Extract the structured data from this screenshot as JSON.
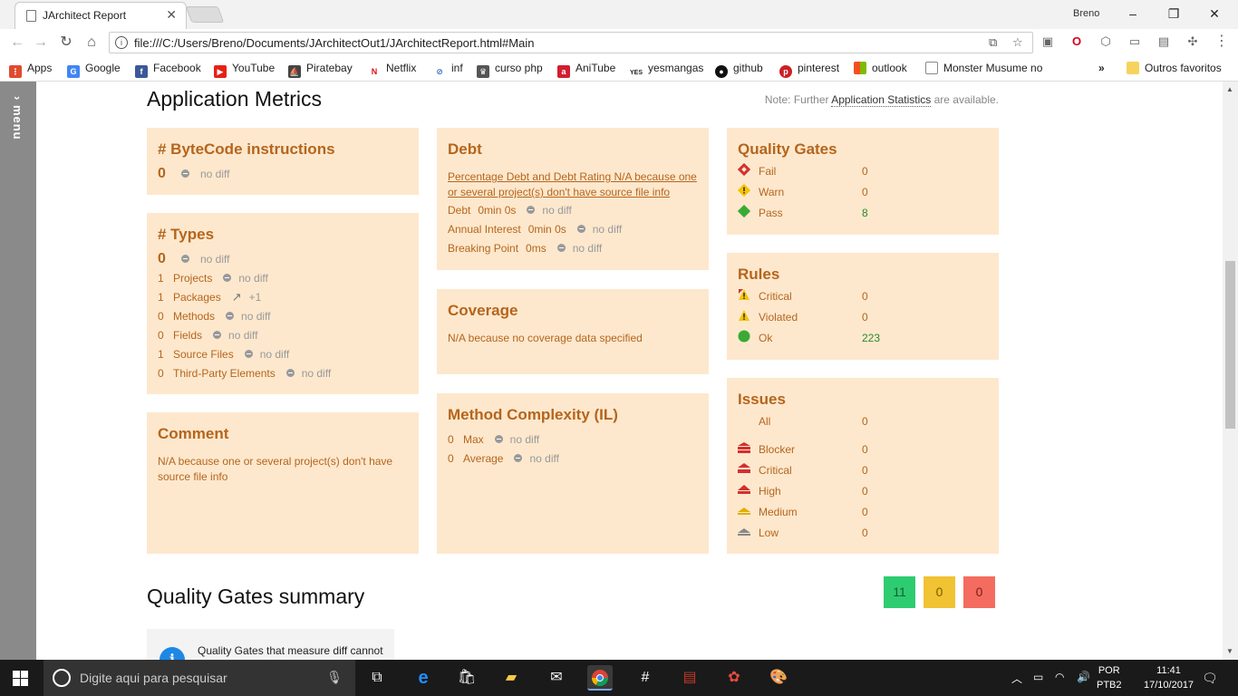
{
  "browser": {
    "tab_title": "JArchitect Report",
    "tab_close": "✕",
    "profile_name": "Breno",
    "url": "file:///C:/Users/Breno/Documents/JArchitectOut1/JArchitectReport.html#Main",
    "window_controls": [
      "–",
      "❐",
      "✕"
    ],
    "bookmarks": [
      {
        "label": "Apps",
        "icon": "apps-grid-icon",
        "color": "#e04a2f"
      },
      {
        "label": "Google",
        "icon": "google-icon",
        "color": "#4285f4"
      },
      {
        "label": "Facebook",
        "icon": "facebook-icon",
        "color": "#3b5998"
      },
      {
        "label": "YouTube",
        "icon": "youtube-icon",
        "color": "#e62117"
      },
      {
        "label": "Piratebay",
        "icon": "pirate-ship-icon",
        "color": "#444444"
      },
      {
        "label": "Netflix",
        "icon": "netflix-icon",
        "color": "#e50914"
      },
      {
        "label": "inf",
        "icon": "link-icon",
        "color": "#3a6bc9"
      },
      {
        "label": "curso php",
        "icon": "php-icon",
        "color": "#555555"
      },
      {
        "label": "AniTube",
        "icon": "anitube-icon",
        "color": "#d01f2f"
      },
      {
        "label": "yesmangas",
        "icon": "yesmangas-icon",
        "color": "#222222"
      },
      {
        "label": "github",
        "icon": "github-icon",
        "color": "#111111"
      },
      {
        "label": "pinterest",
        "icon": "pinterest-icon",
        "color": "#cb2027"
      },
      {
        "label": "outlook",
        "icon": "windows-icon",
        "color": "#f25022"
      },
      {
        "label": "Monster Musume no",
        "icon": "page-icon",
        "color": "#888888"
      }
    ],
    "bookmarks_more": "»",
    "other_bookmarks": "Outros favoritos"
  },
  "page": {
    "menu_label": "menu",
    "title": "Application Metrics",
    "note_prefix": "Note: Further",
    "note_link": "Application Statistics",
    "note_suffix": "are available.",
    "bytecode": {
      "title": "# ByteCode instructions",
      "value": "0",
      "diff": "no diff"
    },
    "types": {
      "title": "# Types",
      "value": "0",
      "diff": "no diff",
      "rows": [
        {
          "num": "1",
          "label": "Projects",
          "diff": "no diff",
          "icon": "no-diff-icon"
        },
        {
          "num": "1",
          "label": "Packages",
          "diff": "+1",
          "icon": "arrow-up-right-icon"
        },
        {
          "num": "0",
          "label": "Methods",
          "diff": "no diff",
          "icon": "no-diff-icon"
        },
        {
          "num": "0",
          "label": "Fields",
          "diff": "no diff",
          "icon": "no-diff-icon"
        },
        {
          "num": "1",
          "label": "Source Files",
          "diff": "no diff",
          "icon": "no-diff-icon"
        },
        {
          "num": "0",
          "label": "Third-Party Elements",
          "diff": "no diff",
          "icon": "no-diff-icon"
        }
      ]
    },
    "comment": {
      "title": "Comment",
      "text": "N/A because one or several project(s) don't have source file info"
    },
    "debt": {
      "title": "Debt",
      "link": "Percentage Debt and Debt Rating N/A because one or several project(s) don't have source file info",
      "rows": [
        {
          "label": "Debt",
          "value": "0min 0s",
          "diff": "no diff"
        },
        {
          "label": "Annual Interest",
          "value": "0min 0s",
          "diff": "no diff"
        },
        {
          "label": "Breaking Point",
          "value": "0ms",
          "diff": "no diff"
        }
      ]
    },
    "coverage": {
      "title": "Coverage",
      "text": "N/A because no coverage data specified"
    },
    "complexity": {
      "title": "Method Complexity (IL)",
      "rows": [
        {
          "num": "0",
          "label": "Max",
          "diff": "no diff"
        },
        {
          "num": "0",
          "label": "Average",
          "diff": "no diff"
        }
      ]
    },
    "quality_gates": {
      "title": "Quality Gates",
      "rows": [
        {
          "label": "Fail",
          "count": "0",
          "icon": "fail-diamond-icon",
          "color": "#d32f2f"
        },
        {
          "label": "Warn",
          "count": "0",
          "icon": "warn-diamond-icon",
          "color": "#f5c400"
        },
        {
          "label": "Pass",
          "count": "8",
          "icon": "pass-diamond-icon",
          "color": "#3aaa35"
        }
      ]
    },
    "rules": {
      "title": "Rules",
      "rows": [
        {
          "label": "Critical",
          "count": "0",
          "icon": "critical-warning-icon"
        },
        {
          "label": "Violated",
          "count": "0",
          "icon": "warning-icon"
        },
        {
          "label": "Ok",
          "count": "223",
          "icon": "ok-circle-icon"
        }
      ]
    },
    "issues": {
      "title": "Issues",
      "all_label": "All",
      "all_count": "0",
      "rows": [
        {
          "label": "Blocker",
          "count": "0",
          "icon": "blocker-icon",
          "color": "#d32f2f"
        },
        {
          "label": "Critical",
          "count": "0",
          "icon": "critical-icon",
          "color": "#d32f2f"
        },
        {
          "label": "High",
          "count": "0",
          "icon": "high-icon",
          "color": "#d32f2f"
        },
        {
          "label": "Medium",
          "count": "0",
          "icon": "medium-icon",
          "color": "#f5c400"
        },
        {
          "label": "Low",
          "count": "0",
          "icon": "low-icon",
          "color": "#888888"
        }
      ]
    },
    "qg_summary": {
      "title": "Quality Gates summary",
      "boxes": [
        {
          "value": "11",
          "color": "#2ecc71",
          "text_color": "#1a5e33"
        },
        {
          "value": "0",
          "color": "#f1c232",
          "text_color": "#7a5c00"
        },
        {
          "value": "0",
          "color": "#f36c5f",
          "text_color": "#7a1f16"
        }
      ],
      "info_text": "Quality Gates that measure diff cannot"
    }
  },
  "taskbar": {
    "search_placeholder": "Digite aqui para pesquisar",
    "lang_top": "POR",
    "lang_bottom": "PTB2",
    "time": "11:41",
    "date": "17/10/2017"
  }
}
